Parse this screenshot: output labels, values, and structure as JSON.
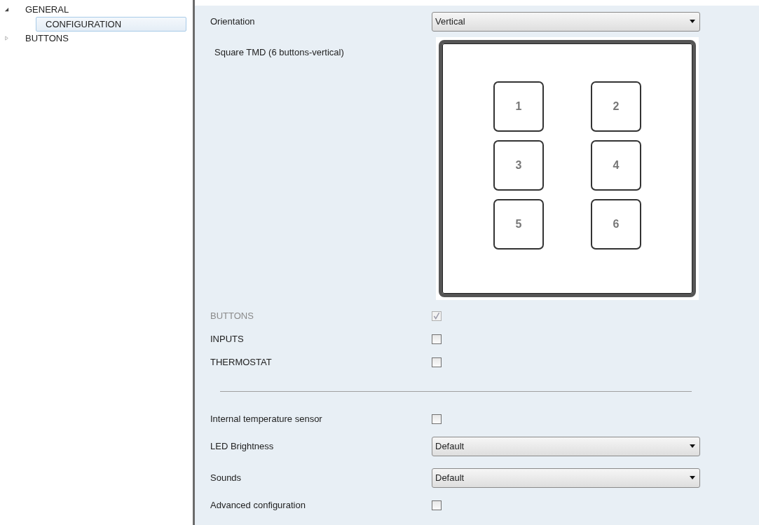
{
  "sidebar": {
    "items": [
      {
        "label": "GENERAL",
        "expanded": true,
        "selected": false,
        "children": [
          {
            "label": "CONFIGURATION",
            "selected": true
          }
        ]
      },
      {
        "label": "BUTTONS",
        "expanded": false,
        "selected": false
      }
    ]
  },
  "settings": [
    {
      "kind": "dropdown",
      "label": "Orientation",
      "value": "Vertical"
    },
    {
      "kind": "device",
      "label": "Square TMD (6 buttons-vertical)",
      "keys": [
        "1",
        "2",
        "3",
        "4",
        "5",
        "6"
      ]
    },
    {
      "kind": "checkbox",
      "label": "BUTTONS",
      "checked": true,
      "disabled": true
    },
    {
      "kind": "checkbox",
      "label": "INPUTS",
      "checked": false,
      "disabled": false
    },
    {
      "kind": "checkbox",
      "label": "THERMOSTAT",
      "checked": false,
      "disabled": false
    },
    {
      "kind": "separator"
    },
    {
      "kind": "checkbox",
      "label": "Internal temperature sensor",
      "checked": false,
      "disabled": false
    },
    {
      "kind": "dropdown",
      "label": "LED Brightness",
      "value": "Default"
    },
    {
      "kind": "dropdown",
      "label": "Sounds",
      "value": "Default"
    },
    {
      "kind": "checkbox",
      "label": "Advanced configuration",
      "checked": false,
      "disabled": false
    }
  ]
}
